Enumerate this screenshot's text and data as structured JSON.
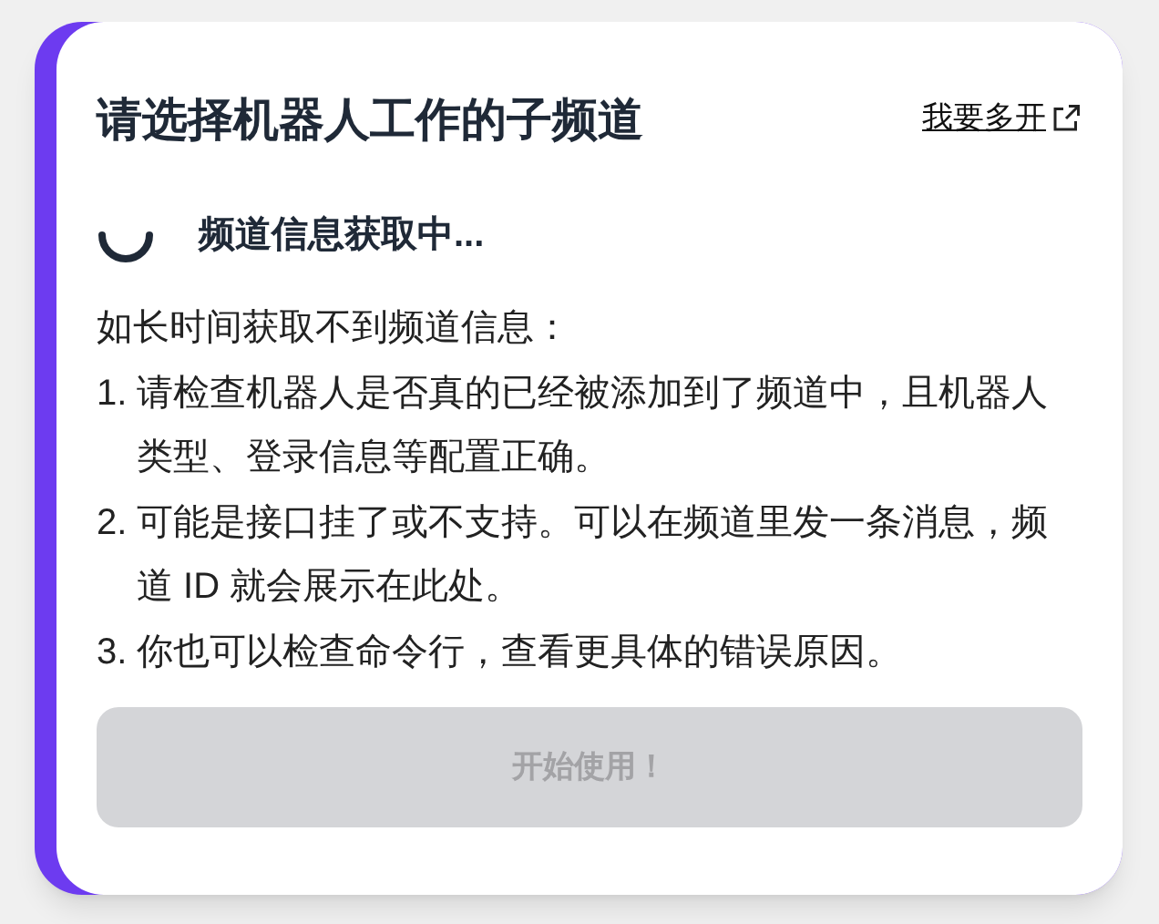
{
  "title": "请选择机器人工作的子频道",
  "multi_link": {
    "label": "我要多开"
  },
  "status": {
    "loading": true,
    "text": "频道信息获取中..."
  },
  "help": {
    "intro": "如长时间获取不到频道信息：",
    "items": [
      {
        "number": "1.",
        "text": "请检查机器人是否真的已经被添加到了频道中，且机器人类型、登录信息等配置正确。"
      },
      {
        "number": "2.",
        "text": "可能是接口挂了或不支持。可以在频道里发一条消息，频道 ID 就会展示在此处。"
      },
      {
        "number": "3.",
        "text": "你也可以检查命令行，查看更具体的错误原因。"
      }
    ]
  },
  "start_button": {
    "label": "开始使用！",
    "disabled": true
  }
}
